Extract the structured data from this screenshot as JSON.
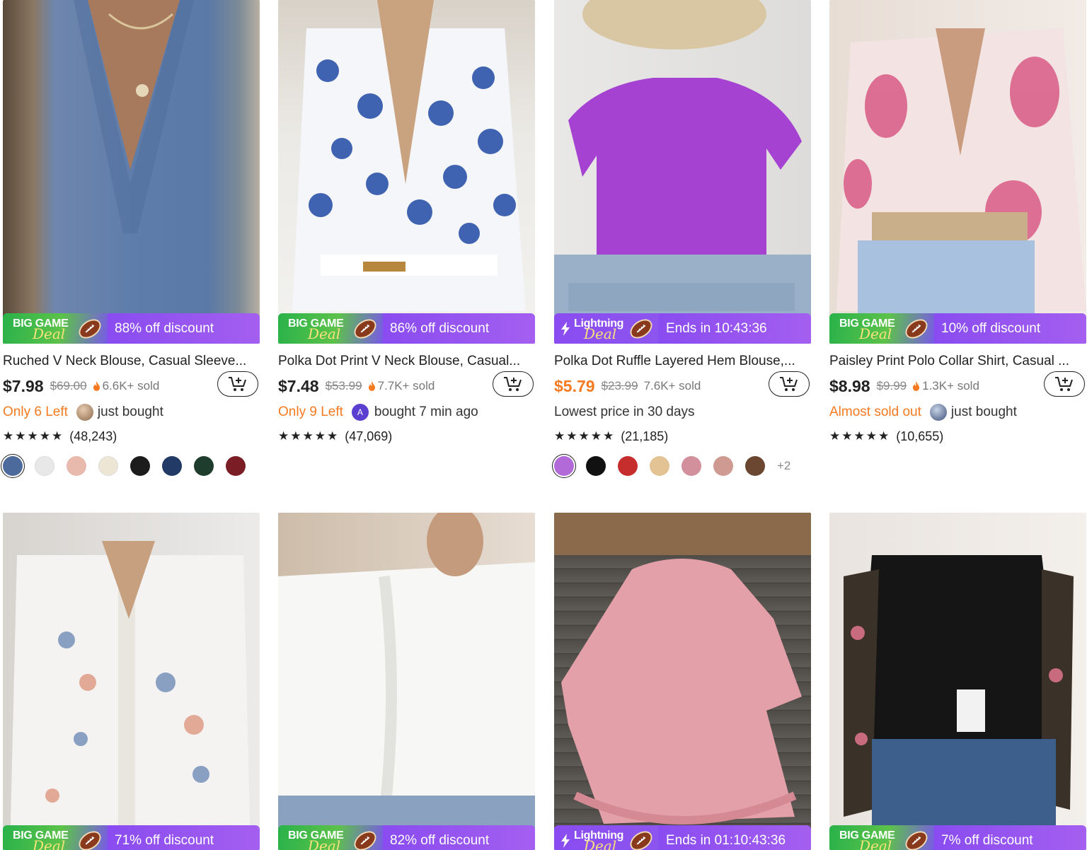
{
  "accent": {
    "orange": "#f57a20",
    "purple": "#9a55ef",
    "green": "#2fb34a"
  },
  "products": [
    {
      "badge": {
        "type": "big-game",
        "line1": "BIG GAME",
        "line2": "Deal",
        "text": "88% off discount"
      },
      "title": "Ruched V Neck Blouse, Casual Sleeve...",
      "price": "$7.98",
      "was": "$69.00",
      "sold": "6.6K+ sold",
      "urgency": "Only 6 Left",
      "activity": "just bought",
      "stars": "★★★★★",
      "reviews": "(48,243)",
      "swatches": [
        "#4d6a9c",
        "#e8e8e8",
        "#e8b9ad",
        "#ede6d5",
        "#1c1c1c",
        "#223a66",
        "#1f3d2c",
        "#7a1d24"
      ]
    },
    {
      "badge": {
        "type": "big-game",
        "line1": "BIG GAME",
        "line2": "Deal",
        "text": "86% off discount"
      },
      "title": "Polka Dot Print V Neck Blouse, Casual...",
      "price": "$7.48",
      "was": "$53.99",
      "sold": "7.7K+ sold",
      "urgency": "Only 9 Left",
      "avatar_letter": "A",
      "activity": "bought 7 min ago",
      "stars": "★★★★★",
      "reviews": "(47,069)"
    },
    {
      "badge": {
        "type": "lightning",
        "line1": "Lightning",
        "line2": "Deal",
        "text": "Ends in 10:43:36"
      },
      "title": "Polka Dot Ruffle Layered Hem Blouse,...",
      "price": "$5.79",
      "was": "$23.99",
      "sold": "7.6K+ sold",
      "note": "Lowest price in 30 days",
      "stars": "★★★★★",
      "reviews": "(21,185)",
      "swatches": [
        "#b26ad8",
        "#111111",
        "#c62e2e",
        "#e3c394",
        "#d2909c",
        "#cf9a92",
        "#6b4630"
      ],
      "more": "+2"
    },
    {
      "badge": {
        "type": "big-game",
        "line1": "BIG GAME",
        "line2": "Deal",
        "text": "10% off discount"
      },
      "title": "Paisley Print Polo Collar Shirt, Casual ...",
      "price": "$8.98",
      "was": "$9.99",
      "sold": "1.3K+ sold",
      "urgency": "Almost sold out",
      "activity": "just bought",
      "stars": "★★★★★",
      "reviews": "(10,655)"
    },
    {
      "badge": {
        "type": "big-game",
        "line1": "BIG GAME",
        "line2": "Deal",
        "text": "71% off discount"
      }
    },
    {
      "badge": {
        "type": "big-game",
        "line1": "BIG GAME",
        "line2": "Deal",
        "text": "82% off discount"
      }
    },
    {
      "badge": {
        "type": "lightning",
        "line1": "Lightning",
        "line2": "Deal",
        "text": "Ends in 01:10:43:36"
      }
    },
    {
      "badge": {
        "type": "big-game",
        "line1": "BIG GAME",
        "line2": "Deal",
        "text": "7% off discount"
      }
    }
  ]
}
